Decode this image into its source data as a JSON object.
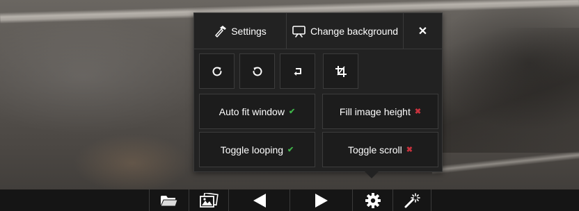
{
  "settings_panel": {
    "tabs": {
      "settings_label": "Settings",
      "change_background_label": "Change background",
      "close_label": "✕"
    },
    "tools": [
      {
        "name": "rotate-clockwise",
        "icon": "rotate-cw-icon"
      },
      {
        "name": "rotate-counterclockwise",
        "icon": "rotate-ccw-icon"
      },
      {
        "name": "flip",
        "icon": "flip-icon"
      },
      {
        "name": "crop",
        "icon": "crop-icon"
      }
    ],
    "options": {
      "auto_fit_window": {
        "label": "Auto fit window",
        "mark": "✔",
        "enabled": true
      },
      "fill_image_height": {
        "label": "Fill image height",
        "mark": "✖",
        "enabled": false
      },
      "toggle_looping": {
        "label": "Toggle looping",
        "mark": "✔",
        "enabled": true
      },
      "toggle_scroll": {
        "label": "Toggle scroll",
        "mark": "✖",
        "enabled": false
      }
    }
  },
  "toolbar": {
    "buttons": [
      {
        "name": "open-folder",
        "icon": "folder-icon"
      },
      {
        "name": "gallery",
        "icon": "images-icon"
      },
      {
        "name": "previous",
        "icon": "left-triangle-icon"
      },
      {
        "name": "next",
        "icon": "right-triangle-icon"
      },
      {
        "name": "settings",
        "icon": "gear-icon"
      },
      {
        "name": "effects",
        "icon": "magic-wand-icon"
      }
    ]
  },
  "colors": {
    "panel_bg": "#222222",
    "check_on": "#3fb44a",
    "check_off": "#c7323d",
    "toolbar_bg": "#151515"
  }
}
